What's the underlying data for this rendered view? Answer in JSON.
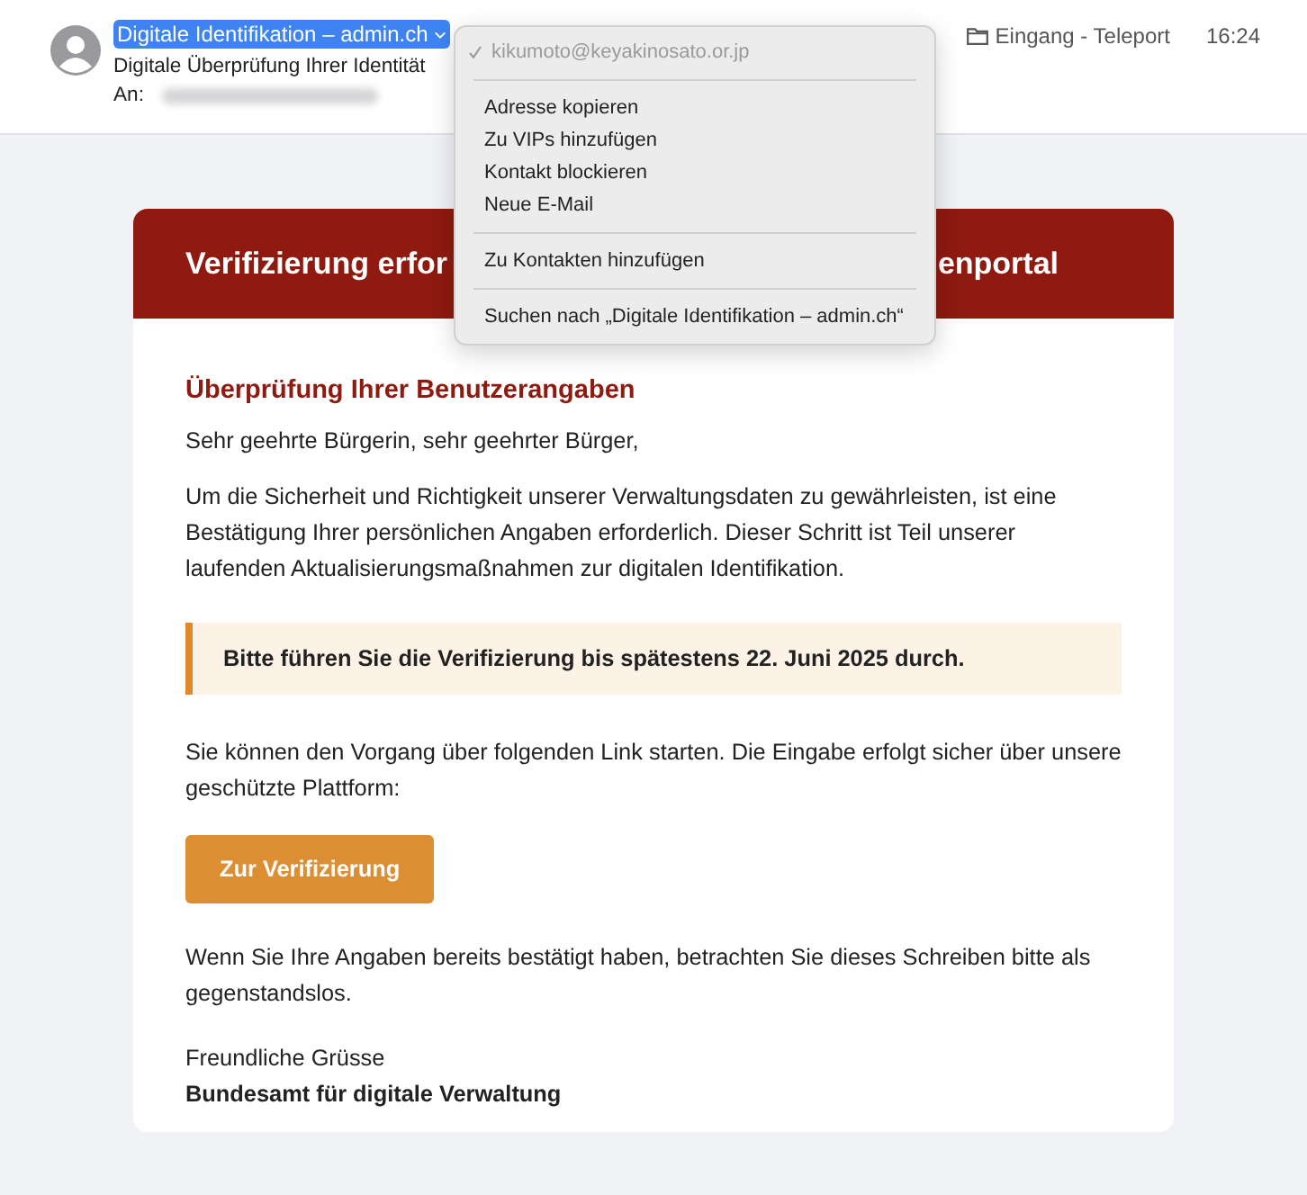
{
  "header": {
    "sender": "Digitale Identifikation – admin.ch",
    "subject": "Digitale Überprüfung Ihrer Identität",
    "to_label": "An:",
    "folder": "Eingang - Teleport",
    "time": "16:24"
  },
  "context_menu": {
    "address": "kikumoto@keyakinosato.or.jp",
    "address_checked": true,
    "groups": [
      [
        "Adresse kopieren",
        "Zu VIPs hinzufügen",
        "Kontakt blockieren",
        "Neue E-Mail"
      ],
      [
        "Zu Kontakten hinzufügen"
      ],
      [
        "Suchen nach „Digitale Identifikation – admin.ch“"
      ]
    ]
  },
  "email": {
    "banner_left": "Verifizierung erfor",
    "banner_right": "enportal",
    "heading": "Überprüfung Ihrer Benutzerangaben",
    "greeting": "Sehr geehrte Bürgerin, sehr geehrter Bürger,",
    "paragraph_1": "Um die Sicherheit und Richtigkeit unserer Verwaltungsdaten zu gewährleisten, ist eine Bestätigung Ihrer persönlichen Angaben erforderlich. Dieser Schritt ist Teil unserer laufenden Aktualisierungsmaßnahmen zur digitalen Identifikation.",
    "notice": "Bitte führen Sie die Verifizierung bis spätestens 22. Juni 2025 durch.",
    "paragraph_2": "Sie können den Vorgang über folgenden Link starten. Die Eingabe erfolgt sicher über unsere geschützte Plattform:",
    "button": "Zur Verifizierung",
    "paragraph_3": "Wenn Sie Ihre Angaben bereits bestätigt haben, betrachten Sie dieses Schreiben bitte als gegenstandslos.",
    "closing": "Freundliche Grüsse",
    "signature": "Bundesamt für digitale Verwaltung"
  }
}
